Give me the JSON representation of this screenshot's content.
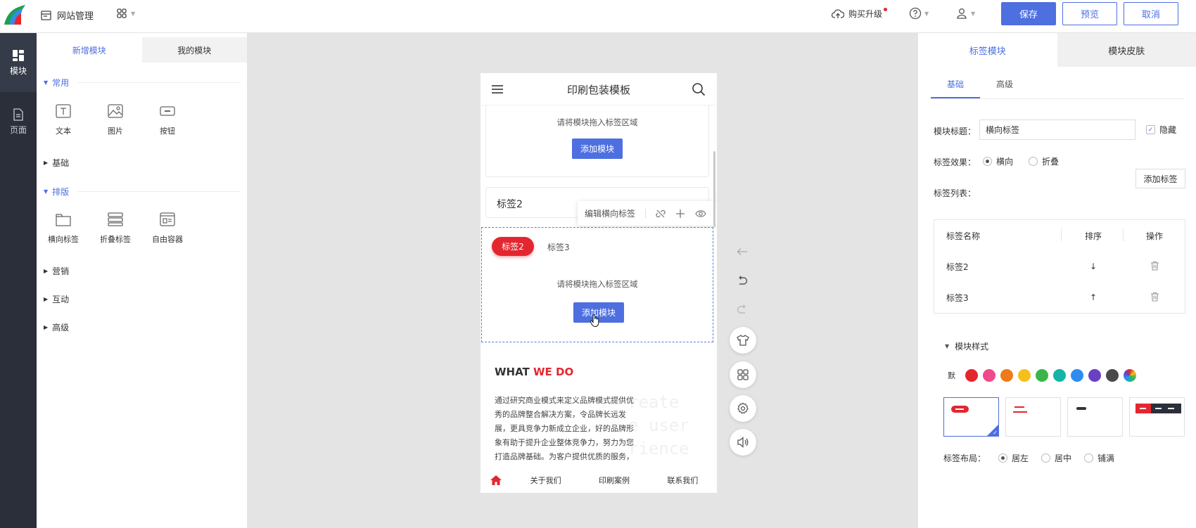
{
  "topbar": {
    "site_mgmt": "网站管理",
    "buy_upgrade": "购买升级",
    "save": "保存",
    "preview": "预览",
    "cancel": "取消"
  },
  "rail": {
    "modules": "模块",
    "pages": "页面"
  },
  "module_panel": {
    "tab_new": "新增模块",
    "tab_mine": "我的模块",
    "group_common": "常用",
    "items_common": [
      "文本",
      "图片",
      "按钮"
    ],
    "group_basic": "基础",
    "group_layout": "排版",
    "items_layout": [
      "横向标签",
      "折叠标签",
      "自由容器"
    ],
    "group_marketing": "营销",
    "group_interact": "互动",
    "group_advanced": "高级"
  },
  "phone": {
    "title": "印刷包装模板",
    "hint": "请将模块拖入标签区域",
    "add_module": "添加模块",
    "fold_label": "标签2",
    "tooltip_text": "编辑横向标签",
    "tab_active": "标签2",
    "tab_other": "标签3",
    "what": "WHAT",
    "we_do": "WE DO",
    "paragraph": "通过研究商业模式来定义品牌模式提供优秀的品牌整合解决方案，令品牌长远发展，更具竞争力新成立企业，好的品牌形象有助于提升企业整体竞争力，努力为您打造品牌基础。为客户提供优质的服务，",
    "ghost_lines": [
      "reate",
      "e user",
      "rience"
    ],
    "nav": [
      "关于我们",
      "印刷案例",
      "联系我们"
    ]
  },
  "right_panel": {
    "tab_module": "标签模块",
    "tab_skin": "模块皮肤",
    "sub_basic": "基础",
    "sub_advanced": "高级",
    "label_title": "模块标题：",
    "title_value": "横向标签",
    "hide": "隐藏",
    "label_effect": "标签效果：",
    "effect_horizontal": "横向",
    "effect_fold": "折叠",
    "label_list": "标签列表：",
    "add_tag": "添加标签",
    "table_headers": [
      "标签名称",
      "排序",
      "操作"
    ],
    "rows": [
      {
        "name": "标签2",
        "sort": "↓"
      },
      {
        "name": "标签3",
        "sort": "↑"
      }
    ],
    "style_head": "模块样式",
    "default_swatch": "默",
    "colors": [
      "#e4262f",
      "#f04a8c",
      "#f07a1a",
      "#f5c01a",
      "#3bb54a",
      "#16b3a8",
      "#2d8cf0",
      "#6a3fc4",
      "#4a4a4a"
    ],
    "label_layout": "标签布局：",
    "layout_left": "居左",
    "layout_center": "居中",
    "layout_fill": "铺满"
  }
}
